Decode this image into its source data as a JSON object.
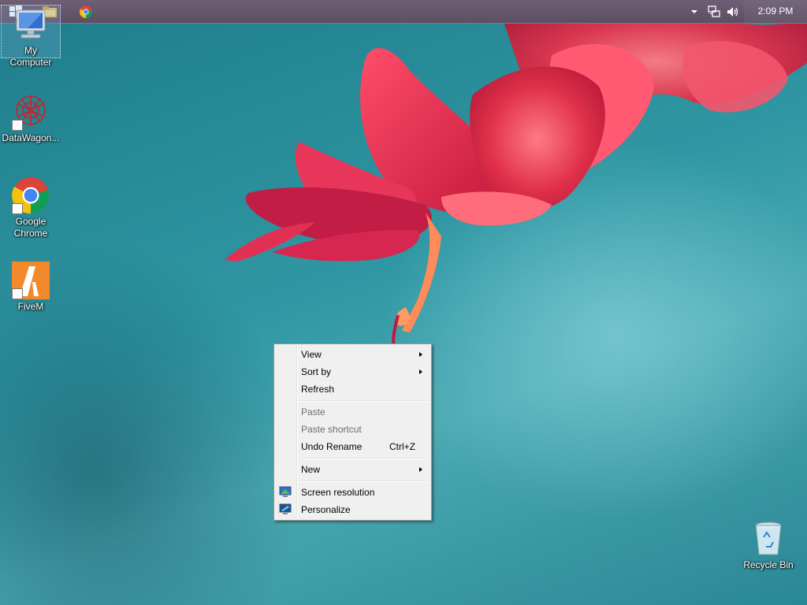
{
  "taskbar": {
    "clock": "2:09 PM",
    "start_icon": "windows-logo-icon",
    "pinned": [
      "file-explorer-icon",
      "chrome-icon"
    ],
    "tray_icons": [
      "show-hidden-icons-chevron-icon",
      "network-icon",
      "volume-icon"
    ]
  },
  "desktop": {
    "icons": [
      {
        "label": "My Computer",
        "icon": "my-computer-icon"
      },
      {
        "label": "DataWagon...",
        "icon": "datawagon-icon"
      },
      {
        "label": "Google Chrome",
        "icon": "chrome-icon"
      },
      {
        "label": "FiveM",
        "icon": "fivem-icon"
      },
      {
        "label": "Recycle Bin",
        "icon": "recycle-bin-icon"
      }
    ]
  },
  "context_menu": {
    "items": {
      "view": "View",
      "sort_by": "Sort by",
      "refresh": "Refresh",
      "paste": "Paste",
      "paste_shortcut": "Paste shortcut",
      "undo_rename": "Undo Rename",
      "undo_rename_shortcut": "Ctrl+Z",
      "new": "New",
      "screen_resolution": "Screen resolution",
      "personalize": "Personalize"
    }
  },
  "colors": {
    "taskbar": "#5d4f63",
    "menu_background": "#f0f0f0",
    "desktop_teal": "#2f97a3",
    "flower": "#e0304a"
  }
}
